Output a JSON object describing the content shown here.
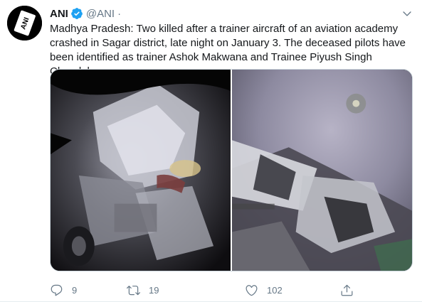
{
  "tweet": {
    "author": {
      "name": "ANI",
      "handle": "@ANI",
      "separator": "·",
      "avatar_text": "ANI",
      "verified": true
    },
    "text": "Madhya Pradesh: Two killed after a trainer aircraft of an aviation academy crashed in Sagar district, late night on January 3. The deceased pilots have been identified as trainer Ashok Makwana and Trainee Piyush Singh Chandel.",
    "media": [
      {
        "name": "crash-photo-left"
      },
      {
        "name": "crash-photo-right"
      }
    ],
    "actions": {
      "reply": {
        "icon": "reply-icon",
        "count": "9"
      },
      "retweet": {
        "icon": "retweet-icon",
        "count": "19"
      },
      "like": {
        "icon": "heart-icon",
        "count": "102"
      },
      "share": {
        "icon": "share-icon",
        "count": ""
      }
    }
  },
  "colors": {
    "text_primary": "#14171a",
    "text_secondary": "#657786",
    "verified_blue": "#1da1f2",
    "border": "#e6ecf0"
  }
}
